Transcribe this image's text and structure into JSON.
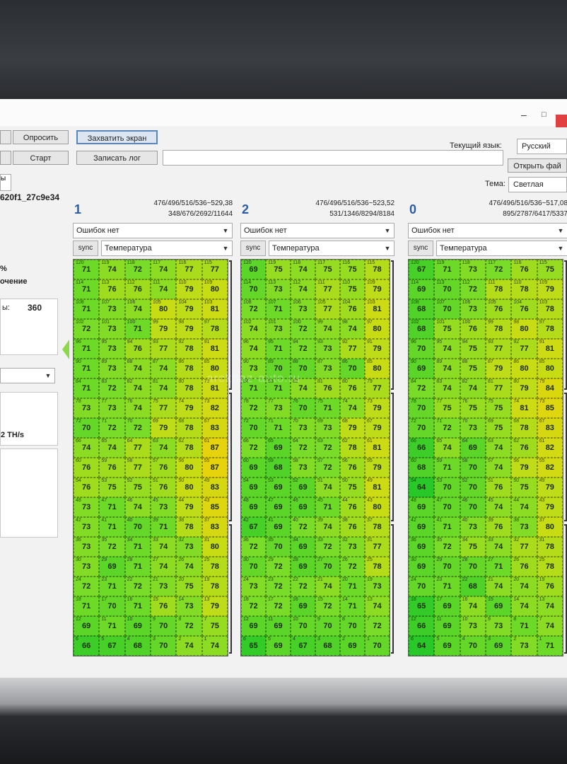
{
  "window": {
    "minimize": "–",
    "maximize": "□"
  },
  "toolbar": {
    "query_label": "Опросить",
    "capture_label": "Захватить экран",
    "start_label": "Старт",
    "log_label": "Записать лог",
    "log_path": "",
    "lang_label": "Текущий язык:",
    "lang_value": "Русский",
    "open_file_label": "Открыть фай",
    "theme_label": "Тема:",
    "theme_value": "Светлая"
  },
  "left": {
    "tab_label": "ы",
    "device_id": "620f1_27c9e34",
    "pct": "%",
    "status_word": "очение",
    "metric_label": "ы:",
    "metric_value": "360",
    "hashrate": "2 TH/s"
  },
  "watermark": "arckhaz-auto.ru",
  "columns": [
    {
      "num": "1",
      "stats1": "476/496/516/536~529,38",
      "stats2": "348/676/2692/11644",
      "errors": "Ошибок нет",
      "sync": "sync",
      "mode": "Температура",
      "rows": [
        [
          71,
          74,
          72,
          74,
          77,
          77
        ],
        [
          71,
          76,
          76,
          74,
          79,
          80
        ],
        [
          71,
          73,
          74,
          80,
          79,
          81
        ],
        [
          72,
          73,
          71,
          79,
          79,
          78
        ],
        [
          71,
          73,
          76,
          77,
          78,
          81
        ],
        [
          71,
          73,
          74,
          74,
          78,
          80
        ],
        [
          71,
          72,
          74,
          74,
          78,
          81
        ],
        [
          73,
          73,
          74,
          77,
          79,
          82
        ],
        [
          70,
          72,
          72,
          79,
          78,
          83
        ],
        [
          74,
          74,
          77,
          74,
          78,
          87
        ],
        [
          76,
          76,
          77,
          76,
          80,
          87
        ],
        [
          76,
          75,
          75,
          76,
          80,
          83
        ],
        [
          73,
          71,
          74,
          73,
          79,
          85
        ],
        [
          73,
          71,
          70,
          71,
          78,
          83
        ],
        [
          73,
          72,
          71,
          74,
          73,
          80
        ],
        [
          73,
          69,
          71,
          74,
          74,
          78
        ],
        [
          72,
          71,
          72,
          73,
          75,
          78
        ],
        [
          71,
          70,
          71,
          76,
          73,
          79
        ],
        [
          69,
          71,
          69,
          70,
          72,
          75
        ],
        [
          66,
          67,
          68,
          70,
          74,
          74
        ]
      ]
    },
    {
      "num": "2",
      "stats1": "476/496/516/536~523,52",
      "stats2": "531/1346/8294/8184",
      "errors": "Ошибок нет",
      "sync": "sync",
      "mode": "Температура",
      "rows": [
        [
          69,
          75,
          74,
          75,
          75,
          78
        ],
        [
          70,
          73,
          74,
          77,
          75,
          79
        ],
        [
          72,
          71,
          73,
          77,
          76,
          81
        ],
        [
          74,
          73,
          72,
          74,
          74,
          80
        ],
        [
          74,
          71,
          72,
          73,
          77,
          79
        ],
        [
          73,
          70,
          70,
          73,
          70,
          80
        ],
        [
          71,
          71,
          74,
          76,
          76,
          77
        ],
        [
          72,
          73,
          70,
          71,
          74,
          79
        ],
        [
          70,
          71,
          73,
          73,
          79,
          79
        ],
        [
          72,
          69,
          72,
          72,
          78,
          81
        ],
        [
          69,
          68,
          73,
          72,
          76,
          79
        ],
        [
          69,
          69,
          69,
          74,
          75,
          81
        ],
        [
          69,
          69,
          69,
          71,
          76,
          80
        ],
        [
          67,
          69,
          72,
          74,
          76,
          78
        ],
        [
          72,
          70,
          69,
          72,
          73,
          77
        ],
        [
          70,
          72,
          69,
          70,
          72,
          78
        ],
        [
          73,
          72,
          72,
          74,
          71,
          73
        ],
        [
          72,
          72,
          69,
          72,
          71,
          74
        ],
        [
          69,
          69,
          70,
          70,
          70,
          72
        ],
        [
          65,
          69,
          67,
          68,
          69,
          70
        ]
      ]
    },
    {
      "num": "0",
      "stats1": "476/496/516/536~517,08",
      "stats2": "895/2787/6417/5337",
      "errors": "Ошибок нет",
      "sync": "sync",
      "mode": "Температура",
      "rows": [
        [
          67,
          71,
          73,
          72,
          76,
          75
        ],
        [
          69,
          70,
          72,
          78,
          78,
          79
        ],
        [
          68,
          70,
          73,
          76,
          76,
          78
        ],
        [
          68,
          75,
          76,
          78,
          80,
          78
        ],
        [
          70,
          74,
          75,
          77,
          77,
          81
        ],
        [
          69,
          74,
          75,
          79,
          80,
          80
        ],
        [
          72,
          74,
          74,
          77,
          79,
          84
        ],
        [
          70,
          75,
          75,
          75,
          81,
          85
        ],
        [
          70,
          72,
          73,
          75,
          78,
          83
        ],
        [
          66,
          74,
          69,
          74,
          76,
          82
        ],
        [
          68,
          71,
          70,
          74,
          79,
          82
        ],
        [
          64,
          70,
          70,
          76,
          75,
          79
        ],
        [
          69,
          70,
          70,
          74,
          74,
          79
        ],
        [
          69,
          71,
          73,
          76,
          73,
          80
        ],
        [
          69,
          72,
          75,
          74,
          77,
          78
        ],
        [
          69,
          70,
          70,
          71,
          76,
          78
        ],
        [
          70,
          71,
          68,
          74,
          74,
          76
        ],
        [
          65,
          69,
          74,
          69,
          74,
          74
        ],
        [
          66,
          69,
          73,
          73,
          71,
          74
        ],
        [
          64,
          69,
          70,
          69,
          73,
          71
        ]
      ]
    }
  ]
}
